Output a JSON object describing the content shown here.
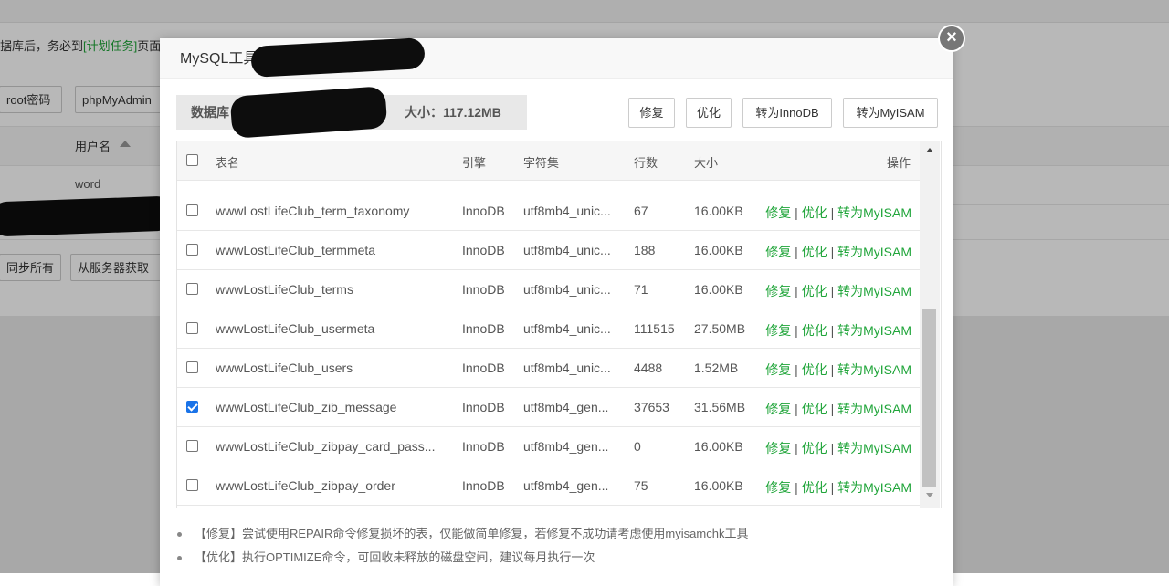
{
  "background": {
    "notice_prefix": "据库后，务必到",
    "notice_link": "[计划任务]",
    "notice_suffix": "页面",
    "root_password_button": "root密码",
    "phpmyadmin_button": "phpMyAdmin",
    "username_header": "用户名",
    "row_user_cell": "word",
    "row_dash": "--",
    "sync_all_button": "同步所有",
    "fetch_from_server_button": "从服务器获取"
  },
  "modal": {
    "title": "MySQL工具箱",
    "title_suffix": "】",
    "close_symbol": "×",
    "db_label": "数据库",
    "size_label": "大小：",
    "size_value": "117.12MB",
    "buttons": {
      "repair": "修复",
      "optimize": "优化",
      "to_innodb": "转为InnoDB",
      "to_myisam": "转为MyISAM"
    },
    "table": {
      "headers": {
        "name": "表名",
        "engine": "引擎",
        "charset": "字符集",
        "rows": "行数",
        "size": "大小",
        "actions": "操作"
      },
      "op_repair": "修复",
      "op_optimize": "优化",
      "op_to_myisam": "转为MyISAM",
      "separator": "|",
      "rows": [
        {
          "name": "wwwLostLifeClub_term_taxonomy",
          "engine": "InnoDB",
          "charset": "utf8mb4_unic...",
          "rows": "67",
          "size": "16.00KB",
          "checked": false
        },
        {
          "name": "wwwLostLifeClub_termmeta",
          "engine": "InnoDB",
          "charset": "utf8mb4_unic...",
          "rows": "188",
          "size": "16.00KB",
          "checked": false
        },
        {
          "name": "wwwLostLifeClub_terms",
          "engine": "InnoDB",
          "charset": "utf8mb4_unic...",
          "rows": "71",
          "size": "16.00KB",
          "checked": false
        },
        {
          "name": "wwwLostLifeClub_usermeta",
          "engine": "InnoDB",
          "charset": "utf8mb4_unic...",
          "rows": "111515",
          "size": "27.50MB",
          "checked": false
        },
        {
          "name": "wwwLostLifeClub_users",
          "engine": "InnoDB",
          "charset": "utf8mb4_unic...",
          "rows": "4488",
          "size": "1.52MB",
          "checked": false
        },
        {
          "name": "wwwLostLifeClub_zib_message",
          "engine": "InnoDB",
          "charset": "utf8mb4_gen...",
          "rows": "37653",
          "size": "31.56MB",
          "checked": true
        },
        {
          "name": "wwwLostLifeClub_zibpay_card_pass...",
          "engine": "InnoDB",
          "charset": "utf8mb4_gen...",
          "rows": "0",
          "size": "16.00KB",
          "checked": false
        },
        {
          "name": "wwwLostLifeClub_zibpay_order",
          "engine": "InnoDB",
          "charset": "utf8mb4_gen...",
          "rows": "75",
          "size": "16.00KB",
          "checked": false
        }
      ]
    },
    "notes": [
      "【修复】尝试使用REPAIR命令修复损坏的表，仅能做简单修复，若修复不成功请考虑使用myisamchk工具",
      "【优化】执行OPTIMIZE命令，可回收未释放的磁盘空间，建议每月执行一次"
    ]
  }
}
